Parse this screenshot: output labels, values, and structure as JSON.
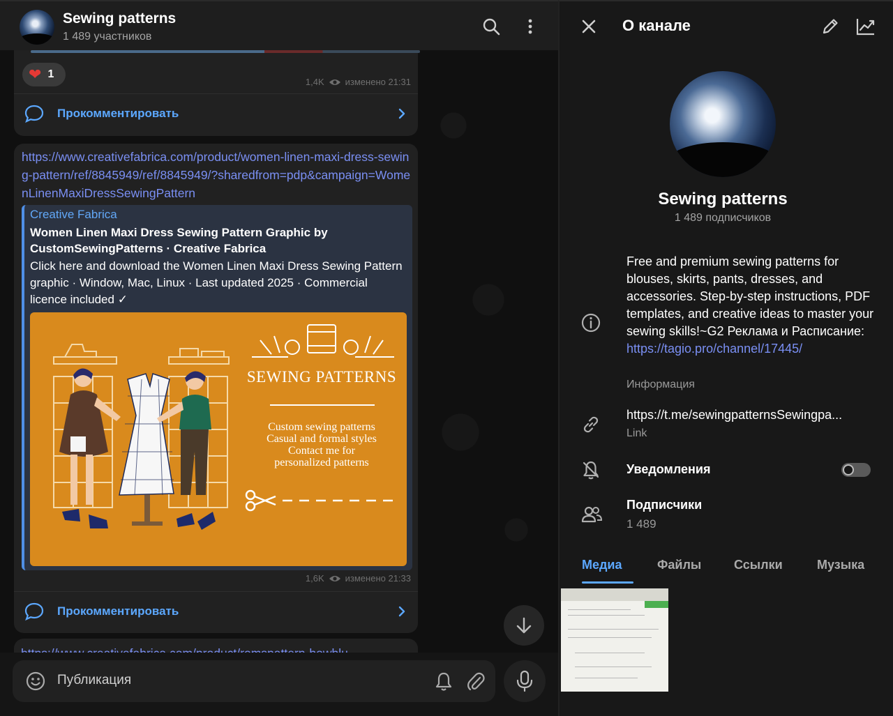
{
  "chat": {
    "title": "Sewing patterns",
    "subtitle": "1 489 участников",
    "post1": {
      "reaction_emoji": "❤",
      "reaction_count": "1",
      "views": "1,4K",
      "edited": "изменено 21:31",
      "comment_label": "Прокомментировать"
    },
    "post2": {
      "url": "https://www.creativefabrica.com/product/women-linen-maxi-dress-sewing-pattern/ref/8845949/ref/8845949/?sharedfrom=pdp&campaign=WomenLinenMaxiDressSewingPattern",
      "preview": {
        "site": "Creative Fabrica",
        "title": "Women Linen Maxi Dress Sewing Pattern Graphic by CustomSewingPatterns · Creative Fabrica",
        "description": "Click here and download the Women Linen Maxi Dress Sewing Pattern graphic · Window, Mac, Linux · Last updated 2025 · Commercial licence included ✓",
        "image_brand": "SEWING PATTERNS",
        "image_tagline_1": "Custom sewing patterns",
        "image_tagline_2": "Casual and formal styles",
        "image_tagline_3": "Contact me for",
        "image_tagline_4": "personalized patterns"
      },
      "views": "1,6K",
      "edited": "изменено 21:33",
      "comment_label": "Прокомментировать"
    },
    "next_url": "https://www.creativefabrica.com/product/romspattern-bowblu",
    "composer_placeholder": "Публикация"
  },
  "panel": {
    "title": "О канале",
    "name": "Sewing patterns",
    "subscribers_line": "1 489 подписчиков",
    "description": "Free and premium sewing patterns for blouses, skirts, pants, dresses, and accessories. Step-by-step instructions, PDF templates, and creative ideas to master your sewing skills!~G2 Реклама и Расписание: ",
    "description_link": "https://tagio.pro/channel/17445/",
    "description_label": "Информация",
    "link": "https://t.me/sewingpatternsSewingpa...",
    "link_label": "Link",
    "notifications_label": "Уведомления",
    "notifications_on": false,
    "subscribers_label": "Подписчики",
    "subscribers_count": "1 489",
    "tabs": [
      "Медиа",
      "Файлы",
      "Ссылки",
      "Музыка"
    ],
    "active_tab": "Медиа"
  },
  "colors": {
    "accent": "#5ca8ff",
    "link": "#7a8ff3",
    "preview_bg": "#2b3342",
    "preview_image": "#d98a1d"
  },
  "icons": [
    "search-icon",
    "more-vertical-icon",
    "heart-icon",
    "eye-icon",
    "comment-icon",
    "chevron-right-icon",
    "arrow-down-icon",
    "emoji-icon",
    "bell-icon",
    "paperclip-icon",
    "microphone-icon",
    "close-icon",
    "pencil-icon",
    "stats-icon",
    "info-icon",
    "link-icon",
    "bell-off-icon",
    "users-icon"
  ]
}
